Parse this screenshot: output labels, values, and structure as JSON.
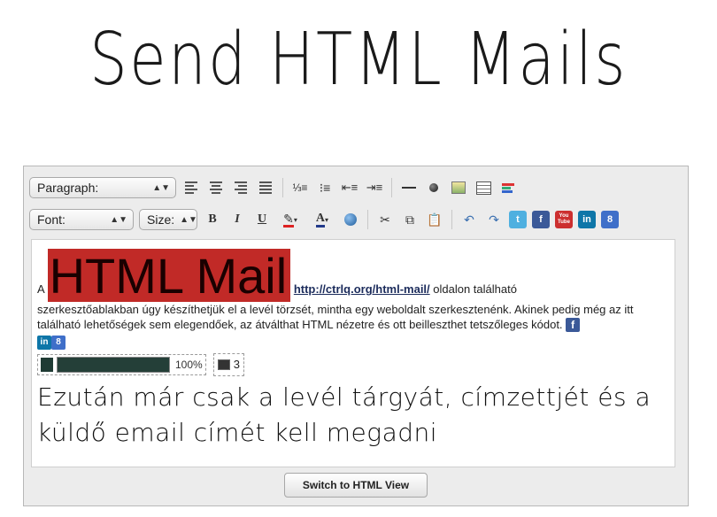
{
  "page": {
    "title": "Send HTML Mails"
  },
  "toolbar1": {
    "format_select": {
      "value": "Paragraph:"
    }
  },
  "toolbar2": {
    "font_select": {
      "value": "Font:"
    },
    "size_select": {
      "value": "Size:"
    },
    "bold_label": "B",
    "italic_label": "I",
    "underline_label": "U"
  },
  "content": {
    "paragraph_prefix": "A",
    "big_title": "HTML Mail",
    "link_text": "http://ctrlq.org/html-mail/",
    "link_suffix": " oldalon található",
    "paragraph_body": "szerkesztőablakban úgy készíthetjük el a levél törzsét, mintha egy weboldalt szerkesztenénk. Akinek pedig még az itt található lehetőségek sem elegendőek, az átválthat HTML nézetre és ott beilleszthet tetszőleges kódot.",
    "progress": {
      "value": 1.0,
      "label": "100%"
    },
    "counter_value": "3",
    "handwritten_line1": "Ezután már csak a levél tárgyát, címzettjét és a",
    "handwritten_line2": "küldő email címét kell megadni"
  },
  "icons": {
    "facebook": "f",
    "linkedin": "in",
    "google": "8",
    "twitter": "t",
    "youtube": "You Tube"
  },
  "colors": {
    "highlight_red": "#c12a27",
    "facebook_blue": "#3b5998",
    "linkedin_blue": "#0e76a8",
    "google_blue": "#3f6fc9",
    "twitter_blue": "#4fb0e0",
    "youtube_red": "#cc2f2f",
    "progress_green": "#1f3b34"
  },
  "footer": {
    "switch_button": "Switch to HTML View"
  }
}
